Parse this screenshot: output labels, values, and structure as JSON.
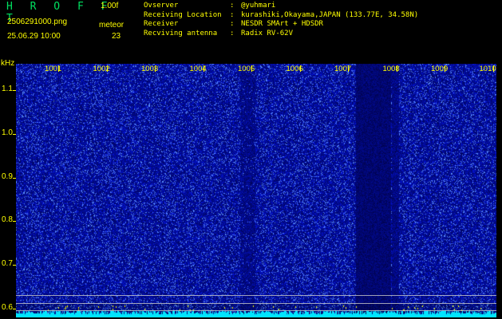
{
  "header": {
    "app_title": "H R O F F T",
    "version": "1.00f",
    "filename": "2506291000.png",
    "datetime": "25.06.29 10:00",
    "meteor_label": "meteor",
    "meteor_count": "23"
  },
  "info": [
    {
      "label": "Ovserver",
      "value": "@yuhmari"
    },
    {
      "label": "Receiving Location",
      "value": "kurashiki,Okayama,JAPAN (133.77E, 34.58N)"
    },
    {
      "label": "Receiver",
      "value": "NESDR SMArt + HDSDR"
    },
    {
      "label": "Recviving antenna",
      "value": "Radix RV-62V"
    }
  ],
  "info_sep": ":",
  "chart_data": {
    "type": "heatmap",
    "ylabel": "kHz",
    "x_ticks": [
      "1001",
      "1002",
      "1003",
      "1004",
      "1005",
      "1006",
      "1007",
      "1008",
      "1009",
      "1010"
    ],
    "y_ticks": [
      "1.1",
      "1.0",
      "0.9",
      "0.8",
      "0.7",
      "0.6"
    ],
    "y_range_khz": [
      0.58,
      1.16
    ],
    "colors": {
      "background": "#000000",
      "signal_low": "#0a1a9a",
      "signal_high": "#b0e0ff",
      "baseline": "#00e5ff",
      "labels": "#ffff00"
    }
  }
}
